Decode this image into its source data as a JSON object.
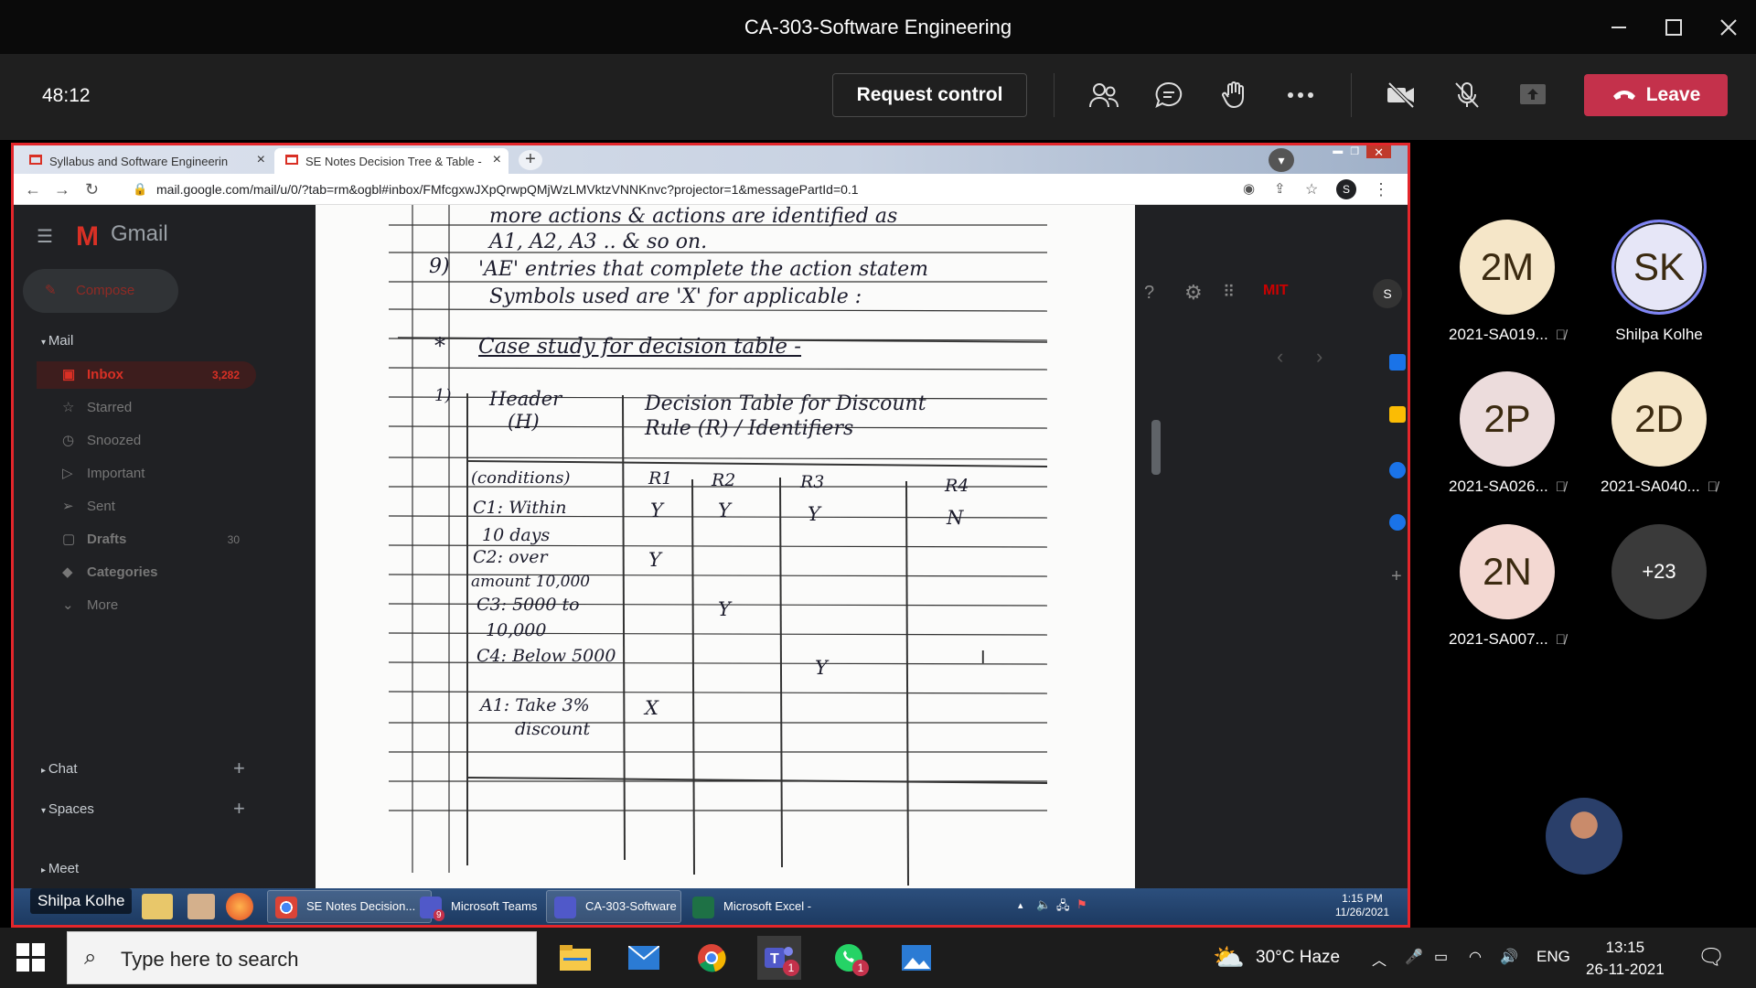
{
  "window": {
    "title": "CA-303-Software Engineering"
  },
  "meeting": {
    "timer": "48:12",
    "request_control": "Request control",
    "leave": "Leave"
  },
  "browser": {
    "tabs": [
      {
        "label": "Syllabus and Software Engineerin"
      },
      {
        "label": "SE Notes Decision Tree & Table -"
      }
    ],
    "url": "mail.google.com/mail/u/0/?tab=rm&ogbl#inbox/FMfcgxwJXpQrwpQMjWzLMVktzVNNKnvc?projector=1&messagePartId=0.1",
    "profile_initial": "S"
  },
  "gmail": {
    "logo": "Gmail",
    "compose": "Compose",
    "mail_section": "Mail",
    "items": [
      {
        "label": "Inbox",
        "count": "3,282",
        "icon": "inbox-icon"
      },
      {
        "label": "Starred",
        "count": "",
        "icon": "star-icon"
      },
      {
        "label": "Snoozed",
        "count": "",
        "icon": "clock-icon"
      },
      {
        "label": "Important",
        "count": "",
        "icon": "important-icon"
      },
      {
        "label": "Sent",
        "count": "",
        "icon": "send-icon"
      },
      {
        "label": "Drafts",
        "count": "30",
        "icon": "draft-icon"
      },
      {
        "label": "Categories",
        "count": "",
        "icon": "label-icon"
      },
      {
        "label": "More",
        "count": "",
        "icon": "chevron-down-icon"
      }
    ],
    "chat": "Chat",
    "spaces": "Spaces",
    "meet": "Meet"
  },
  "notes": {
    "lines": [
      "more actions & actions are identified as",
      "A1, A2, A3 .. & so on.",
      "9)",
      "'AE' entries that complete the action statem",
      "Symbols used are 'X' for applicable :",
      "*",
      "Case study for decision table -",
      "1)",
      "Header",
      "(H)",
      "Decision Table for Discount",
      "Rule (R) / Identifiers"
    ],
    "table": {
      "headers": [
        "(conditions)",
        "R1",
        "R2",
        "R3",
        "R4"
      ],
      "rows": [
        [
          "C1: Within",
          "Y",
          "Y",
          "Y",
          "N"
        ],
        [
          "10 days",
          "",
          "",
          "",
          ""
        ],
        [
          "C2: over",
          "Y",
          "",
          "",
          ""
        ],
        [
          "amount 10,000",
          "",
          "",
          "",
          ""
        ],
        [
          "C3: 5000 to",
          "",
          "Y",
          "",
          ""
        ],
        [
          "10,000",
          "",
          "",
          "",
          ""
        ],
        [
          "C4: Below 5000",
          "",
          "",
          "Y",
          ""
        ],
        [
          "A1: Take 3%",
          "X",
          "",
          "",
          ""
        ],
        [
          "discount",
          "",
          "",
          "",
          ""
        ]
      ]
    }
  },
  "inner_taskbar": {
    "presenter": "Shilpa Kolhe",
    "buttons": [
      "SE Notes Decision...",
      "Microsoft Teams",
      "CA-303-Software ...",
      "Microsoft Excel - ..."
    ],
    "teams_badge": "9",
    "time": "1:15 PM",
    "date": "11/26/2021"
  },
  "participants": [
    {
      "initials": "2M",
      "name": "2021-SA019...",
      "color": "#f5e6c8",
      "muted": true
    },
    {
      "initials": "SK",
      "name": "Shilpa Kolhe",
      "color": "#e6e6f7",
      "muted": false
    },
    {
      "initials": "2P",
      "name": "2021-SA026...",
      "color": "#ecdcdc",
      "muted": true
    },
    {
      "initials": "2D",
      "name": "2021-SA040...",
      "color": "#f5e6c8",
      "muted": true
    },
    {
      "initials": "2N",
      "name": "2021-SA007...",
      "color": "#f3d8d2",
      "muted": true
    },
    {
      "initials": "+23",
      "name": "",
      "color": "#3a3a3a",
      "muted": false
    }
  ],
  "os_taskbar": {
    "search_placeholder": "Type here to search",
    "weather": "30°C  Haze",
    "lang": "ENG",
    "time": "13:15",
    "date": "26-11-2021",
    "teams_badge": "1",
    "whatsapp_badge": "1"
  }
}
